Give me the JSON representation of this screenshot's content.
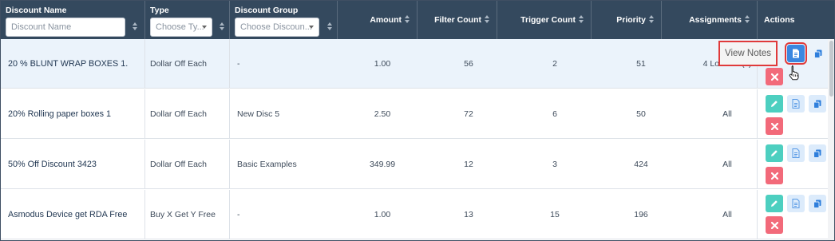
{
  "columns": {
    "name": "Discount Name",
    "type": "Type",
    "group": "Discount Group",
    "amount": "Amount",
    "filter_count": "Filter Count",
    "trigger_count": "Trigger Count",
    "priority": "Priority",
    "assignments": "Assignments",
    "actions": "Actions"
  },
  "filters": {
    "name_placeholder": "Discount Name",
    "type_value": "Choose Ty...",
    "group_value": "Choose Discoun..."
  },
  "rows": [
    {
      "name": "20 % BLUNT WRAP BOXES 1.",
      "type": "Dollar Off Each",
      "group": "-",
      "amount": "1.00",
      "filter_count": "56",
      "trigger_count": "2",
      "priority": "51",
      "assignments": "4 Location(s)"
    },
    {
      "name": "20% Rolling paper boxes 1",
      "type": "Dollar Off Each",
      "group": "New Disc 5",
      "amount": "2.50",
      "filter_count": "72",
      "trigger_count": "6",
      "priority": "50",
      "assignments": "All"
    },
    {
      "name": "50% Off Discount 3423",
      "type": "Dollar Off Each",
      "group": "Basic Examples",
      "amount": "349.99",
      "filter_count": "12",
      "trigger_count": "3",
      "priority": "424",
      "assignments": "All"
    },
    {
      "name": "Asmodus Device get RDA Free",
      "type": "Buy X Get Y Free",
      "group": "-",
      "amount": "1.00",
      "filter_count": "13",
      "trigger_count": "15",
      "priority": "196",
      "assignments": "All"
    }
  ],
  "tooltip": "View Notes",
  "icons": {
    "edit": "pencil-icon",
    "notes": "document-icon",
    "copy": "copy-icon",
    "delete": "close-icon",
    "cursor": "hand-pointer-icon"
  },
  "colors": {
    "header_bg": "#34495e",
    "edit": "#4dcfc0",
    "notes": "#dcebfb",
    "notes_active": "#3b87e0",
    "delete": "#f26a7a",
    "highlight": "#e03a3a"
  }
}
